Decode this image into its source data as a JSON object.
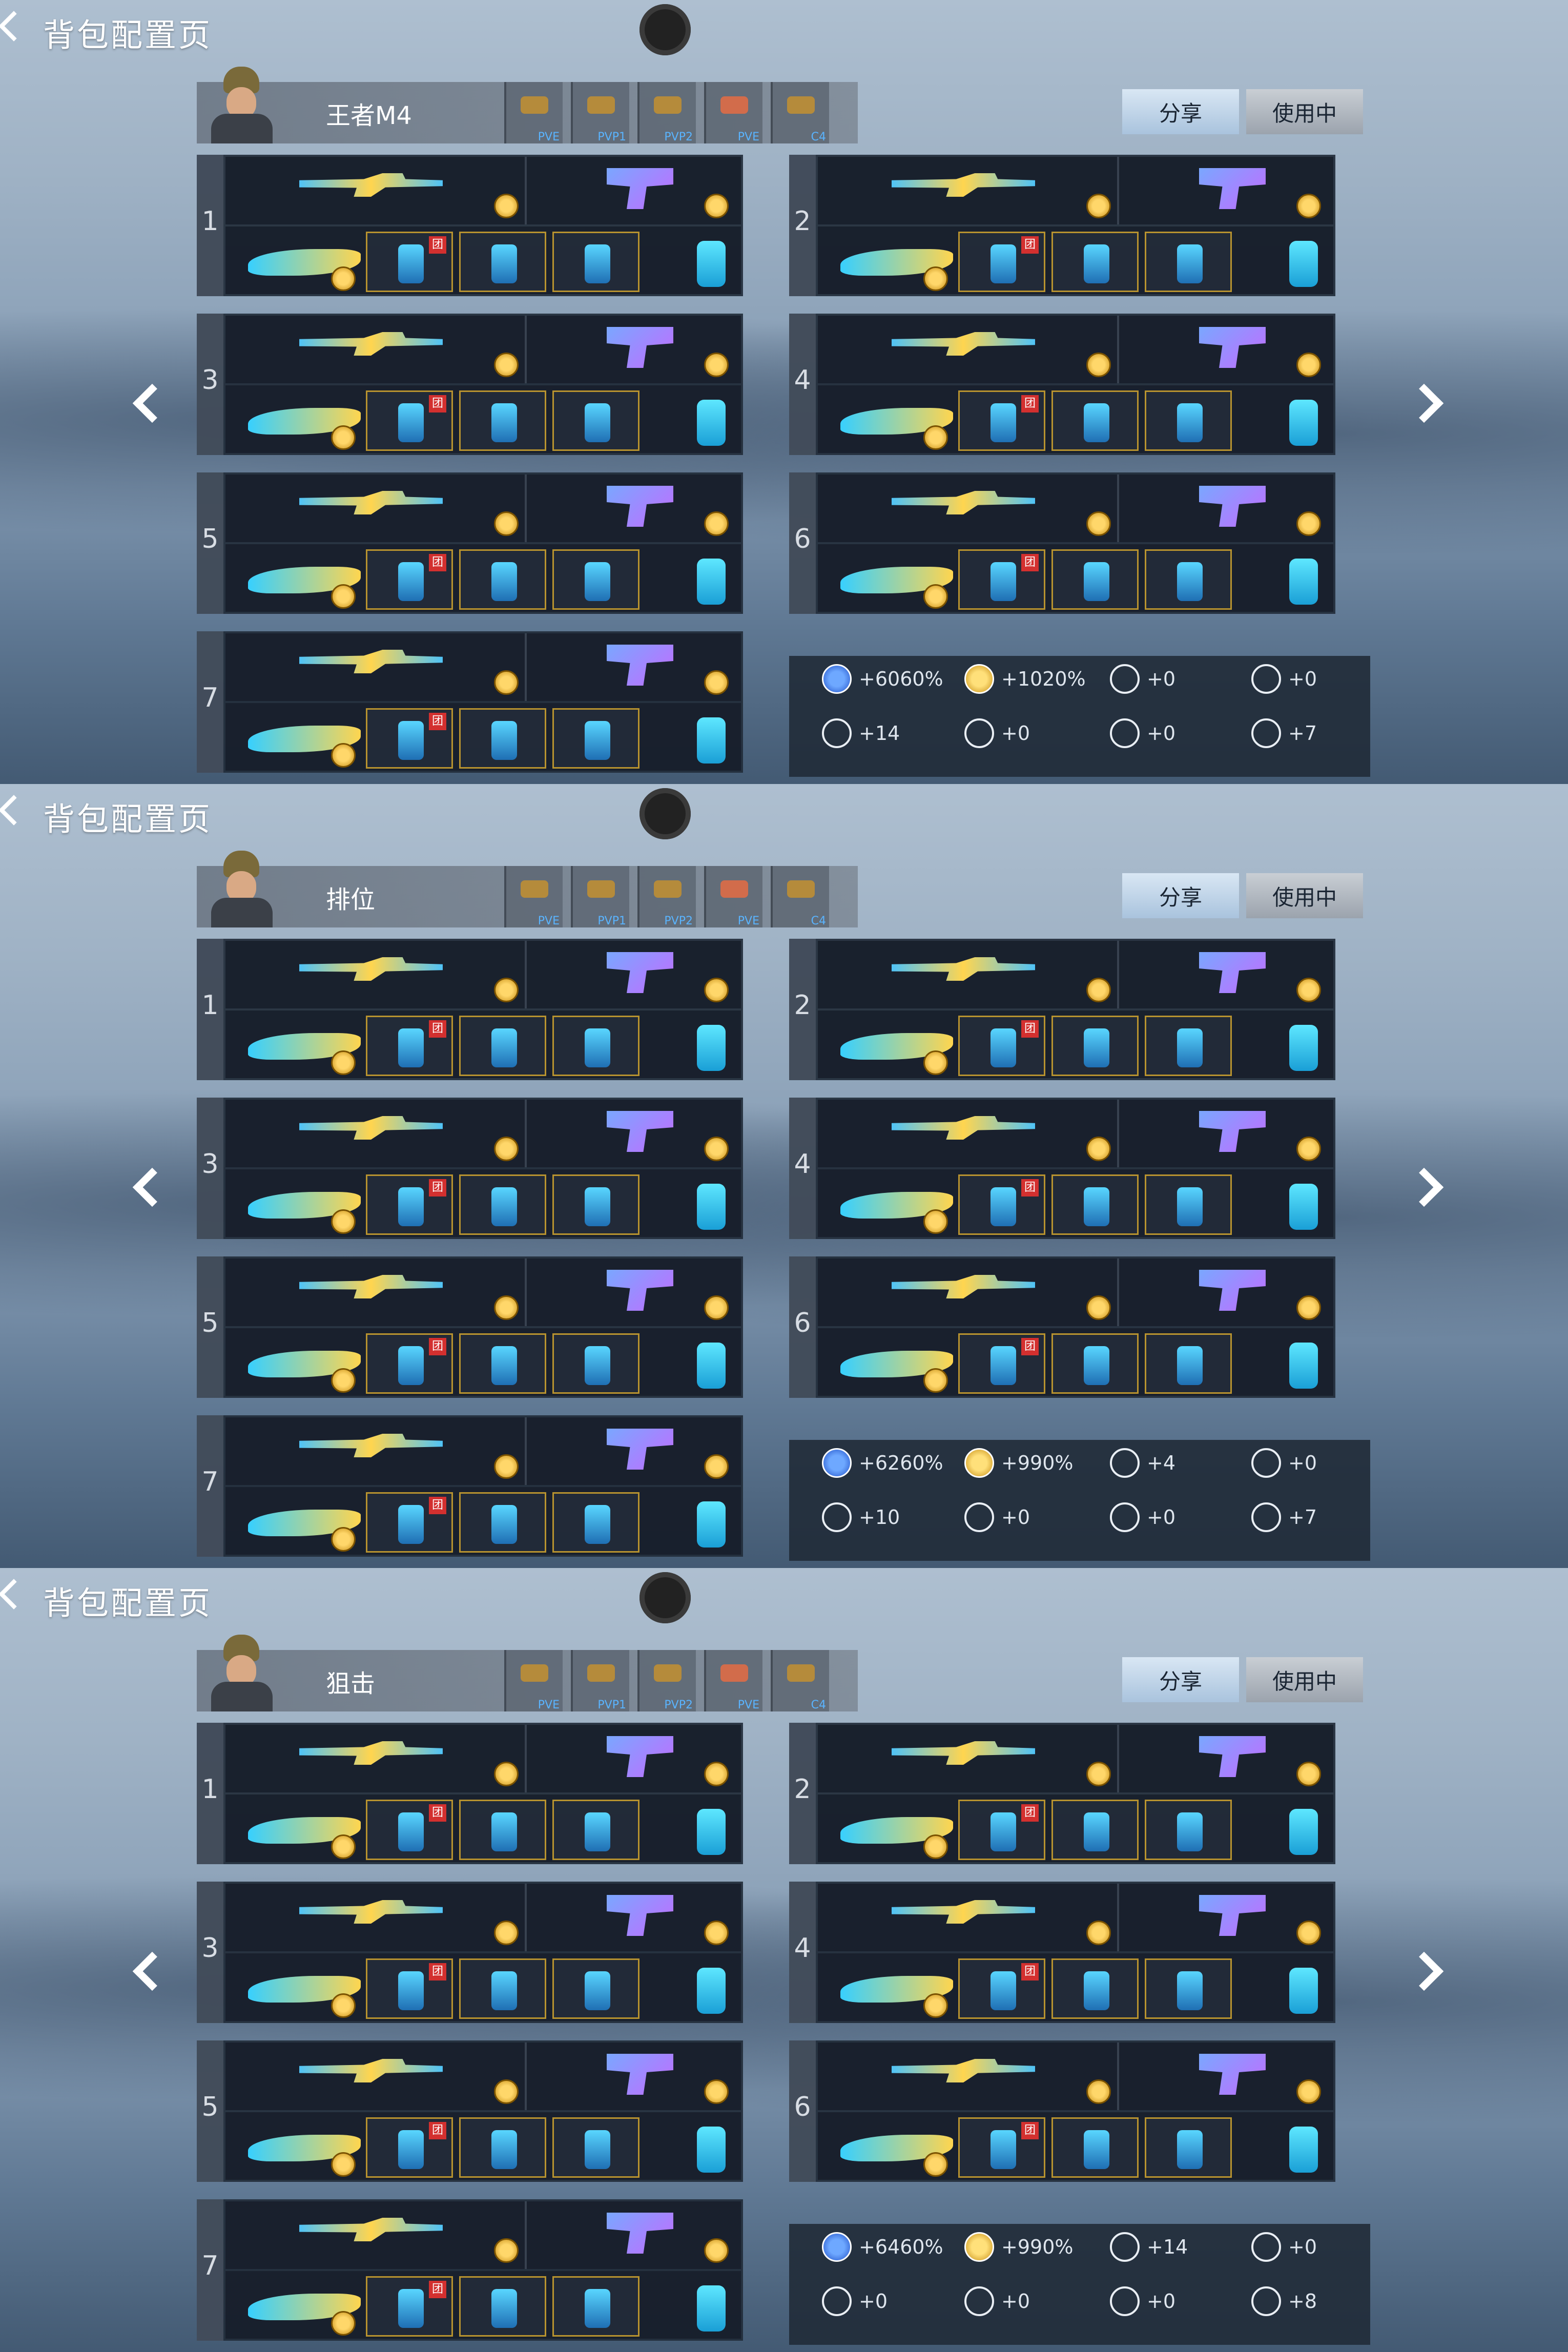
{
  "screens": [
    {
      "page_title": "背包配置页",
      "loadout_name": "王者M4",
      "mode_tabs": [
        "PVE",
        "PVP1",
        "PVP2",
        "PVE",
        "C4"
      ],
      "share_label": "分享",
      "in_use_label": "使用中",
      "slots": [
        "1",
        "2",
        "3",
        "4",
        "5",
        "6",
        "7"
      ],
      "stats": [
        "+6060%",
        "+1020%",
        "+0",
        "+0",
        "+14",
        "+0",
        "+0",
        "+7"
      ]
    },
    {
      "page_title": "背包配置页",
      "loadout_name": "排位",
      "mode_tabs": [
        "PVE",
        "PVP1",
        "PVP2",
        "PVE",
        "C4"
      ],
      "share_label": "分享",
      "in_use_label": "使用中",
      "slots": [
        "1",
        "2",
        "3",
        "4",
        "5",
        "6",
        "7"
      ],
      "stats": [
        "+6260%",
        "+990%",
        "+4",
        "+0",
        "+10",
        "+0",
        "+0",
        "+7"
      ]
    },
    {
      "page_title": "背包配置页",
      "loadout_name": "狙击",
      "mode_tabs": [
        "PVE",
        "PVP1",
        "PVP2",
        "PVE",
        "C4"
      ],
      "share_label": "分享",
      "in_use_label": "使用中",
      "slots": [
        "1",
        "2",
        "3",
        "4",
        "5",
        "6",
        "7"
      ],
      "stats": [
        "+6460%",
        "+990%",
        "+14",
        "+0",
        "+0",
        "+0",
        "+0",
        "+8"
      ]
    }
  ],
  "red_tag_label": "团",
  "icons": [
    "back-chevron-icon",
    "exp-bonus-icon",
    "gold-bonus-icon",
    "weapon-stat-icon",
    "arrow-left-icon",
    "arrow-right-icon"
  ],
  "colors": {
    "accent_blue": "#5ab4ff",
    "gold": "#ffd76a",
    "tag_red": "#d3302f"
  }
}
